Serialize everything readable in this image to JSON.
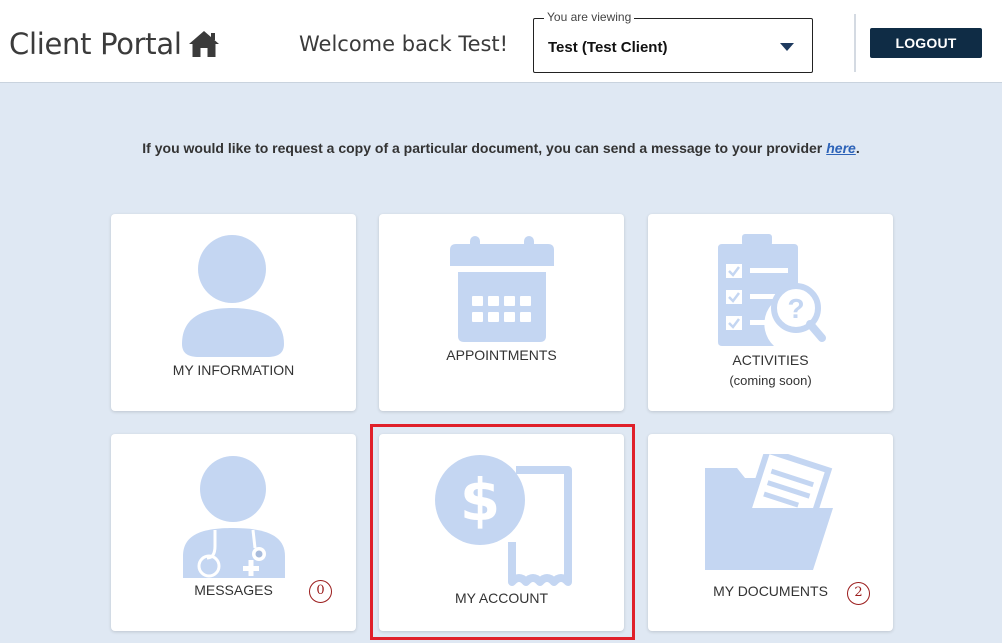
{
  "header": {
    "brand": "Client Portal",
    "welcome": "Welcome back Test!",
    "viewing_legend": "You are viewing",
    "viewing_value": "Test (Test Client)",
    "logout_label": "LOGOUT"
  },
  "notice": {
    "text": "If you would like to request a copy of a particular document, you can send a message to your provider",
    "link_text": "here",
    "suffix": "."
  },
  "tiles": {
    "my_information": {
      "label": "MY INFORMATION",
      "icon": "user-icon"
    },
    "appointments": {
      "label": "APPOINTMENTS",
      "icon": "calendar-icon"
    },
    "activities": {
      "label": "ACTIVITIES",
      "sublabel": "(coming soon)",
      "icon": "clipboard-icon"
    },
    "messages": {
      "label": "MESSAGES",
      "badge": "0",
      "icon": "doctor-icon"
    },
    "my_account": {
      "label": "MY ACCOUNT",
      "icon": "dollar-receipt-icon"
    },
    "my_documents": {
      "label": "MY DOCUMENTS",
      "badge": "2",
      "icon": "folder-icon"
    }
  },
  "colors": {
    "background": "#dfe8f3",
    "icon": "#c4d6f2",
    "logout_bg": "#0f2c45",
    "badge": "#9b1c1c",
    "highlight": "#e0202a",
    "link": "#2d63b8"
  }
}
